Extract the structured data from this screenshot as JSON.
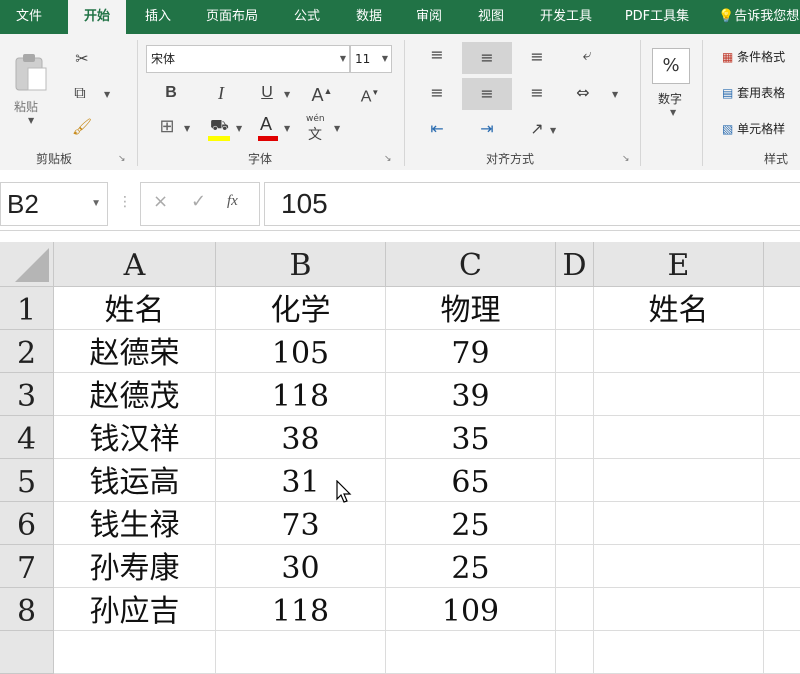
{
  "tabs": [
    "文件",
    "开始",
    "插入",
    "页面布局",
    "公式",
    "数据",
    "审阅",
    "视图",
    "开发工具",
    "PDF工具集",
    "告诉我您想"
  ],
  "ribbon": {
    "clipboard": {
      "paste_label": "粘贴",
      "group_label": "剪贴板"
    },
    "font": {
      "font_name": "宋体",
      "font_size": "11",
      "bold": "B",
      "italic": "I",
      "underline": "U",
      "grow": "A",
      "shrink": "A",
      "fill_letter": "A",
      "phonetic": "文",
      "phonetic_top": "wén",
      "group_label": "字体"
    },
    "alignment": {
      "group_label": "对齐方式"
    },
    "number": {
      "label": "数字",
      "percent": "%"
    },
    "styles": {
      "conditional": "条件格式",
      "table": "套用表格",
      "cell_styles": "单元格样",
      "group_label": "样式"
    },
    "accent_color": "#217346"
  },
  "formula_bar": {
    "name_box": "B2",
    "value": "105",
    "cancel": "×",
    "enter": "✓",
    "fx": "fx"
  },
  "sheet": {
    "columns": [
      "A",
      "B",
      "C",
      "D",
      "E"
    ],
    "rows": [
      {
        "n": "1",
        "cells": [
          "姓名",
          "化学",
          "物理",
          "",
          "姓名"
        ]
      },
      {
        "n": "2",
        "cells": [
          "赵德荣",
          "105",
          "79",
          "",
          ""
        ]
      },
      {
        "n": "3",
        "cells": [
          "赵德茂",
          "118",
          "39",
          "",
          ""
        ]
      },
      {
        "n": "4",
        "cells": [
          "钱汉祥",
          "38",
          "35",
          "",
          ""
        ]
      },
      {
        "n": "5",
        "cells": [
          "钱运高",
          "31",
          "65",
          "",
          ""
        ]
      },
      {
        "n": "6",
        "cells": [
          "钱生禄",
          "73",
          "25",
          "",
          ""
        ]
      },
      {
        "n": "7",
        "cells": [
          "孙寿康",
          "30",
          "25",
          "",
          ""
        ]
      },
      {
        "n": "8",
        "cells": [
          "孙应吉",
          "118",
          "109",
          "",
          ""
        ]
      }
    ]
  }
}
